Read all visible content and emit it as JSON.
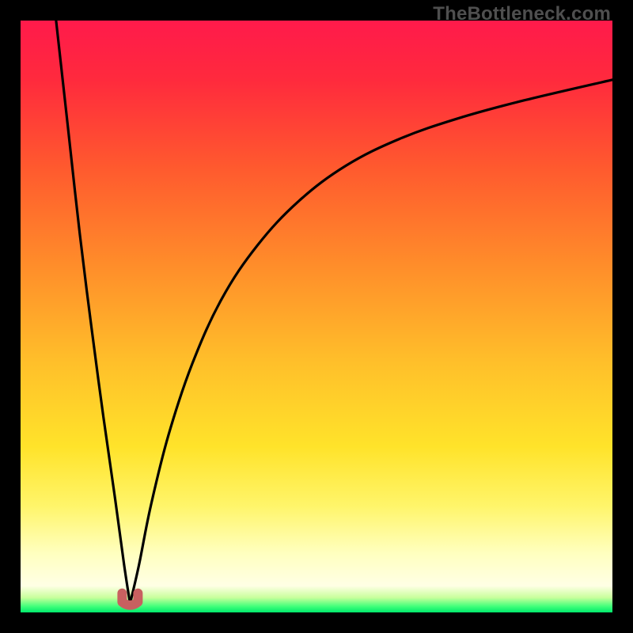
{
  "watermark": "TheBottleneck.com",
  "background": "#000000",
  "gradient_stops": [
    {
      "offset": 0.0,
      "color": "#ff1a4b"
    },
    {
      "offset": 0.1,
      "color": "#ff2a3d"
    },
    {
      "offset": 0.25,
      "color": "#ff5a2e"
    },
    {
      "offset": 0.42,
      "color": "#ff8f2a"
    },
    {
      "offset": 0.58,
      "color": "#ffc02a"
    },
    {
      "offset": 0.72,
      "color": "#ffe32a"
    },
    {
      "offset": 0.82,
      "color": "#fff56a"
    },
    {
      "offset": 0.9,
      "color": "#ffffbf"
    },
    {
      "offset": 0.955,
      "color": "#ffffe5"
    },
    {
      "offset": 0.975,
      "color": "#c8ff9c"
    },
    {
      "offset": 0.99,
      "color": "#3fff7a"
    },
    {
      "offset": 1.0,
      "color": "#00e86b"
    }
  ],
  "marker": {
    "x_frac": 0.185,
    "y_frac": 0.985,
    "color": "#c86060"
  },
  "chart_data": {
    "type": "line",
    "title": "",
    "xlabel": "",
    "ylabel": "",
    "xlim": [
      0,
      1
    ],
    "ylim": [
      0,
      100
    ],
    "series": [
      {
        "name": "left-branch",
        "x": [
          0.06,
          0.08,
          0.1,
          0.12,
          0.14,
          0.16,
          0.175,
          0.185
        ],
        "y": [
          100.0,
          82.0,
          64.0,
          48.0,
          33.0,
          19.0,
          8.0,
          1.5
        ]
      },
      {
        "name": "right-branch",
        "x": [
          0.185,
          0.2,
          0.22,
          0.25,
          0.29,
          0.34,
          0.4,
          0.47,
          0.55,
          0.64,
          0.74,
          0.85,
          1.0
        ],
        "y": [
          1.5,
          8.0,
          18.0,
          30.0,
          42.0,
          53.0,
          62.0,
          69.5,
          75.5,
          80.0,
          83.5,
          86.5,
          90.0
        ]
      }
    ],
    "annotations": [
      {
        "type": "marker",
        "x": 0.185,
        "y": 1.5,
        "label": "optimal-point"
      }
    ]
  }
}
